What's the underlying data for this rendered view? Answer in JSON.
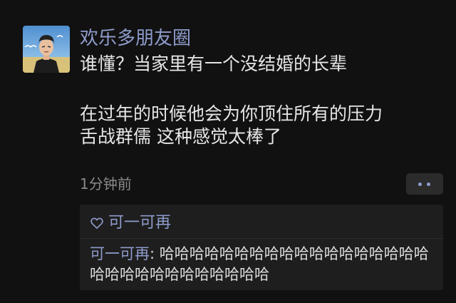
{
  "post": {
    "author": "欢乐多朋友圈",
    "lines": [
      "谁懂？当家里有一个没结婚的长辈",
      "",
      "在过年的时候他会为你顶住所有的压力",
      "舌战群儒 这种感觉太棒了"
    ],
    "timestamp": "1分钟前",
    "more_icon": "more-dots-icon"
  },
  "interactions": {
    "like_icon": "heart-icon",
    "likes": [
      "可一可再"
    ],
    "comments": [
      {
        "author": "可一可再",
        "separator": ": ",
        "text": "哈哈哈哈哈哈哈哈哈哈哈哈哈哈哈哈哈哈哈哈哈哈哈哈哈哈哈哈哈哈"
      }
    ]
  },
  "colors": {
    "background": "#111111",
    "name_link": "#8f9ccc",
    "body_text": "#e6e6e6",
    "muted_text": "#8a8a8a",
    "panel": "#1e1e1e"
  }
}
